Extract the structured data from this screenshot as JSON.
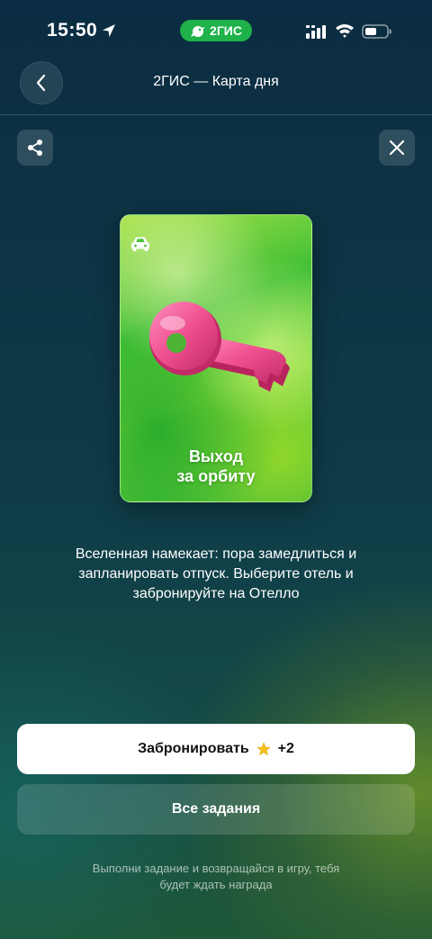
{
  "status_bar": {
    "time": "15:50",
    "app_badge": "2ГИС"
  },
  "nav": {
    "title": "2ГИС — Карта дня"
  },
  "card": {
    "title_line1": "Выход",
    "title_line2": "за орбиту",
    "category_icon": "car-icon",
    "illustration": "key"
  },
  "description": "Вселенная намекает: пора замедлиться и запланировать отпуск. Выберите отель и забронируйте на Отелло",
  "buttons": {
    "book_label": "Забронировать",
    "book_reward": "+2",
    "all_tasks_label": "Все задания"
  },
  "footer_note": "Выполни задание и возвращайся в игру, тебя будет ждать награда",
  "colors": {
    "badge": "#1fb24a",
    "card_green": "#3fbf34",
    "key_pink": "#ef4f8f",
    "star": "#f5c21b"
  }
}
